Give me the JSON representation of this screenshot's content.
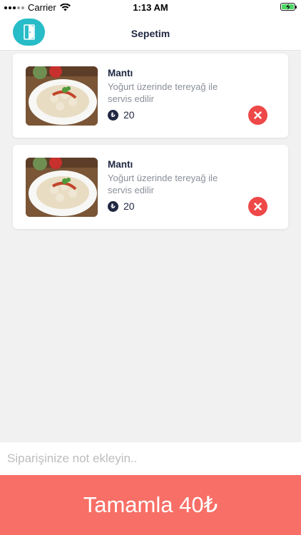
{
  "status_bar": {
    "carrier": "Carrier",
    "time": "1:13 AM"
  },
  "header": {
    "title": "Sepetim",
    "left_button_icon": "door-icon",
    "accent_color": "#27bcc8"
  },
  "cart_items": [
    {
      "name": "Mantı",
      "description": "Yoğurt üzerinde tereyağ  ile servis edilir",
      "currency_symbol": "₺",
      "price": "20"
    },
    {
      "name": "Mantı",
      "description": "Yoğurt üzerinde tereyağ  ile servis edilir",
      "currency_symbol": "₺",
      "price": "20"
    }
  ],
  "note": {
    "placeholder": "Siparişinize not ekleyin.."
  },
  "checkout": {
    "label": "Tamamla 40₺",
    "color": "#f76f66"
  },
  "remove_color": "#ee4848"
}
